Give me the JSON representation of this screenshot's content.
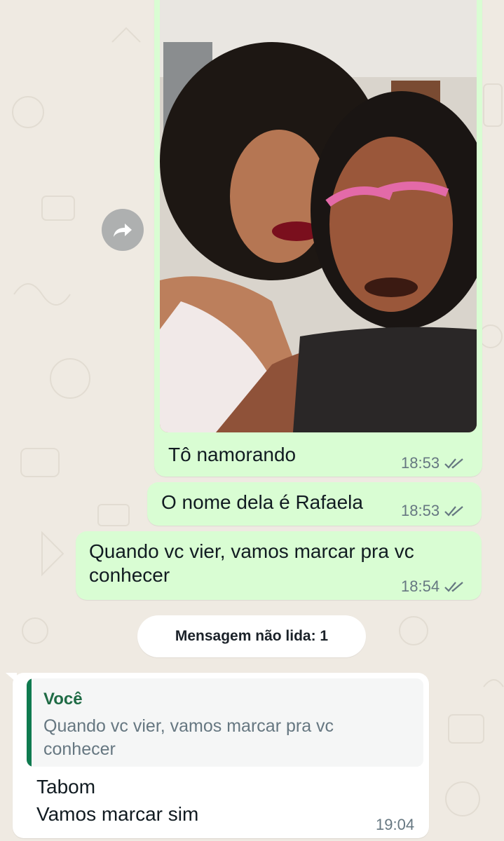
{
  "messages": {
    "m1": {
      "text": "Tô namorando",
      "time": "18:53"
    },
    "m2": {
      "text": "O nome dela é Rafaela",
      "time": "18:53"
    },
    "m3": {
      "text": "Quando vc vier, vamos marcar pra vc conhecer",
      "time": "18:54"
    }
  },
  "unread_banner": "Mensagem não lida: 1",
  "reply": {
    "quoted_author": "Você",
    "quoted_text": "Quando vc vier, vamos marcar pra vc conhecer",
    "line1": "Tabom",
    "line2": "Vamos marcar sim",
    "time": "19:04"
  },
  "colors": {
    "outgoing_bubble": "#d9fdd3",
    "incoming_bubble": "#ffffff",
    "background": "#efeae2",
    "quote_accent": "#0f7a4f"
  },
  "icons": {
    "forward": "forward-icon",
    "read_receipt": "double-check-icon"
  }
}
